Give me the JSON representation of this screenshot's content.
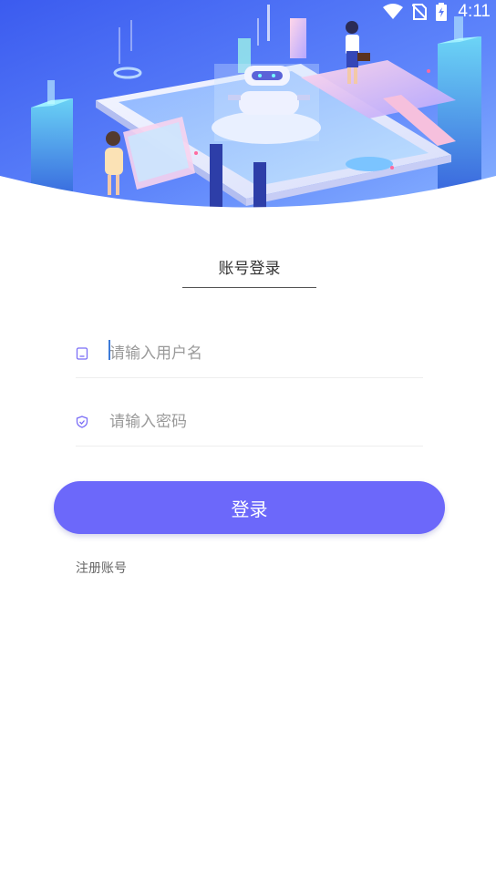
{
  "status_bar": {
    "time": "4:11"
  },
  "login": {
    "tab_title": "账号登录",
    "username_placeholder": "请输入用户名",
    "password_placeholder": "请输入密码",
    "submit_label": "登录",
    "register_label": "注册账号"
  },
  "colors": {
    "accent": "#6c68fa",
    "hero_top": "#3f63f0",
    "hero_bottom": "#7aa8ff",
    "icon_purple": "#7b6ef6"
  }
}
